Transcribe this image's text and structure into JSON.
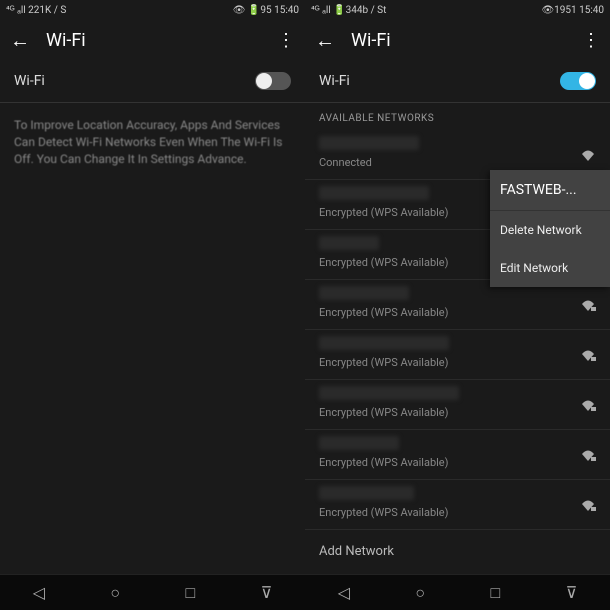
{
  "left": {
    "status": {
      "left": "⁴ᴳ ₐll 221K / S",
      "right": "👁 🔋95 15:40"
    },
    "header": {
      "title": "Wi-Fi"
    },
    "wifi_label": "Wi-Fi",
    "info": "To Improve Location Accuracy, Apps And Services Can Detect Wi-Fi Networks Even When The Wi-Fi Is Off. You Can Change It In Settings Advance."
  },
  "right": {
    "status": {
      "left": "⁴ᴳ ₐll 🔋344b / St",
      "right": "👁1951 15:40"
    },
    "header": {
      "title": "Wi-Fi"
    },
    "wifi_label": "Wi-Fi",
    "section": "AVAILABLE NETWORKS",
    "networks": [
      {
        "status": "Connected"
      },
      {
        "status": "Encrypted (WPS Available)"
      },
      {
        "status": "Encrypted (WPS Available)"
      },
      {
        "status": "Encrypted (WPS Available)"
      },
      {
        "status": "Encrypted (WPS Available)"
      },
      {
        "status": "Encrypted (WPS Available)"
      },
      {
        "status": "Encrypted (WPS Available)"
      },
      {
        "status": "Encrypted (WPS Available)"
      }
    ],
    "add_network": "Add Network"
  },
  "popup": {
    "title": "FASTWEB-...",
    "delete": "Delete Network",
    "edit": "Edit Network"
  }
}
